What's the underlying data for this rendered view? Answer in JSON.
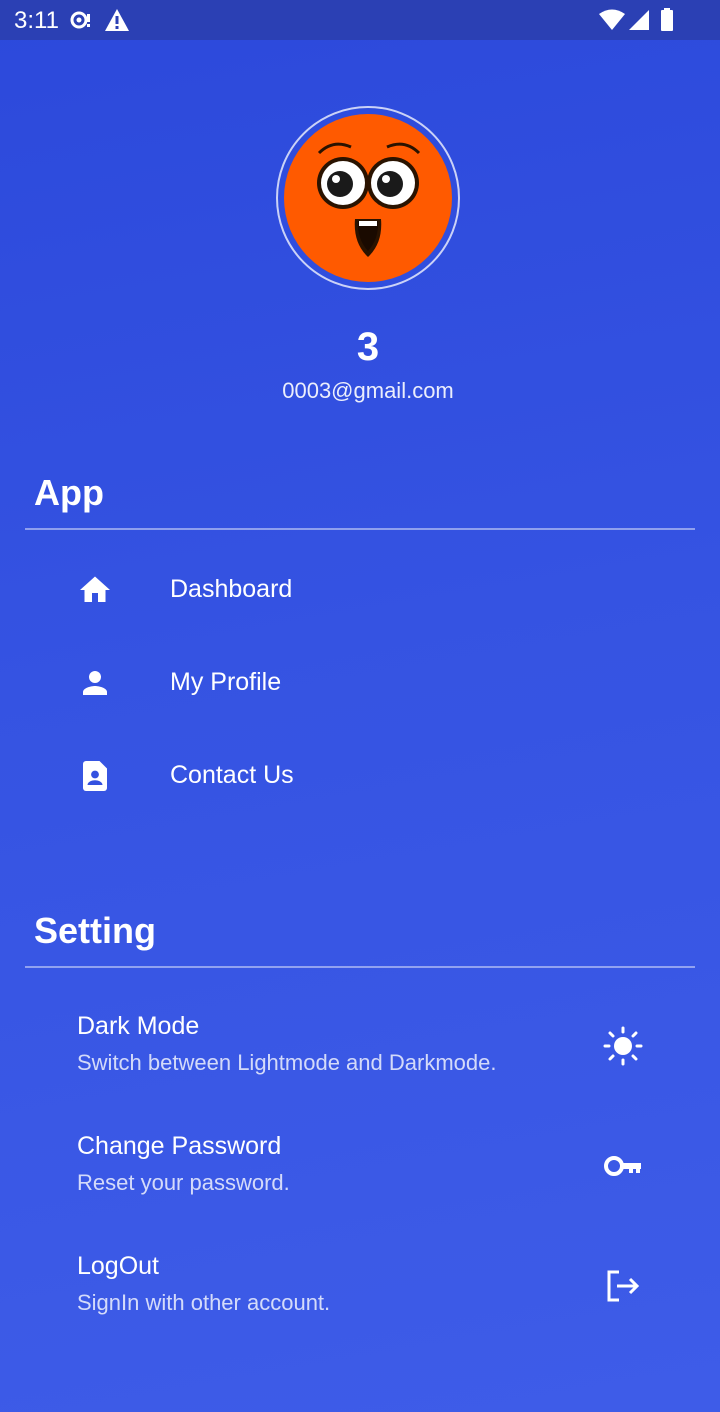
{
  "status_bar": {
    "time": "3:11",
    "icons": [
      "sync-icon",
      "warning-icon",
      "wifi-icon",
      "cell-signal-icon",
      "battery-icon"
    ]
  },
  "profile": {
    "avatar": "emoji-face-avatar",
    "name": "3",
    "email": "0003@gmail.com"
  },
  "app_section": {
    "title": "App",
    "items": [
      {
        "label": "Dashboard",
        "icon": "home-icon"
      },
      {
        "label": "My Profile",
        "icon": "person-icon"
      },
      {
        "label": "Contact Us",
        "icon": "contact-card-icon"
      }
    ]
  },
  "setting_section": {
    "title": "Setting",
    "items": [
      {
        "title": "Dark Mode",
        "subtitle": "Switch between Lightmode and Darkmode.",
        "icon": "sun-icon"
      },
      {
        "title": "Change Password",
        "subtitle": "Reset your password.",
        "icon": "key-icon"
      },
      {
        "title": "LogOut",
        "subtitle": "SignIn with other account.",
        "icon": "logout-icon"
      }
    ]
  },
  "colors": {
    "background_start": "#2c49db",
    "background_end": "#3e5ce8",
    "status_bar": "#2b40b4",
    "avatar_orange": "#ff5a00",
    "text": "#ffffff"
  }
}
